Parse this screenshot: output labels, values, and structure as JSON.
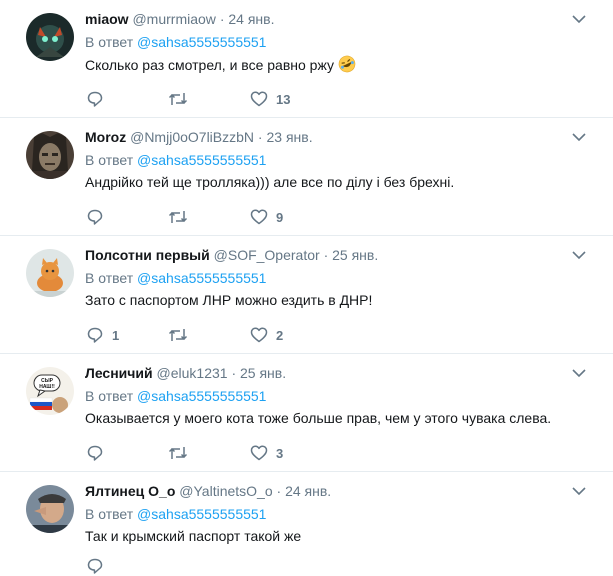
{
  "reply_prefix": "В ответ",
  "reply_to": "@sahsa5555555551",
  "tweets": [
    {
      "name": "miaow",
      "handle": "@murrmiaow",
      "time": "24 янв.",
      "text": "Сколько раз смотрел, и все равно ржу",
      "emoji": "rolling-laughing-emoji",
      "replies": "",
      "retweets": "",
      "likes": "13"
    },
    {
      "name": "Moroz",
      "handle": "@Nmjj0oO7liBzzbN",
      "time": "23 янв.",
      "text": "Андрійко тей ще тролляка))) але все по ділу і без брехні.",
      "replies": "",
      "retweets": "",
      "likes": "9"
    },
    {
      "name": "Полсотни первый",
      "handle": "@SOF_Operator",
      "time": "25 янв.",
      "text": "Зато с паспортом ЛНР можно ездить в ДНР!",
      "replies": "1",
      "retweets": "",
      "likes": "2"
    },
    {
      "name": "Лесничий",
      "handle": "@eluk1231",
      "time": "25 янв.",
      "text": "Оказывается у моего кота тоже больше прав, чем у этого чувака слева.",
      "replies": "",
      "retweets": "",
      "likes": "3"
    },
    {
      "name": "Ялтинец О_о",
      "handle": "@YaltinetsO_o",
      "time": "24 янв.",
      "text": "Так и крымский паспорт такой же",
      "replies": "",
      "retweets": "",
      "likes": ""
    }
  ],
  "avatar4_text": "СЫР НАШ!!",
  "colors": {
    "accent": "#1da1f2",
    "secondary": "#657786",
    "border": "#e6ecf0"
  }
}
